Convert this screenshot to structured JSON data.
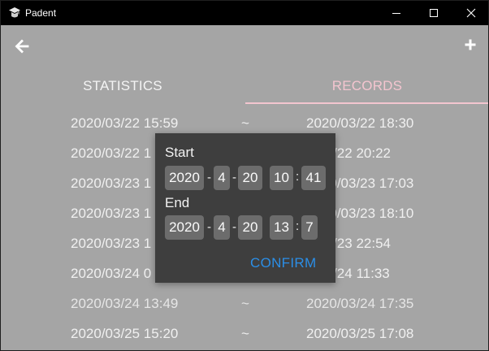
{
  "window": {
    "title": "Padent"
  },
  "tabs": [
    {
      "label": "STATISTICS"
    },
    {
      "label": "RECORDS"
    }
  ],
  "records": [
    {
      "start": "2020/03/22 15:59",
      "sep": "~",
      "end": "2020/03/22 18:30"
    },
    {
      "start": "2020/03/22 1",
      "sep": "~",
      "end": "0/03/22 20:22"
    },
    {
      "start": "2020/03/23 1",
      "sep": "~",
      "end": "2020/03/23 17:03"
    },
    {
      "start": "2020/03/23 1",
      "sep": "~",
      "end": "2020/03/23 18:10"
    },
    {
      "start": "2020/03/23 1",
      "sep": "~",
      "end": "0/03/23 22:54"
    },
    {
      "start": "2020/03/24 0",
      "sep": "~",
      "end": "0/03/24 11:33"
    },
    {
      "start": "2020/03/24 13:49",
      "sep": "~",
      "end": "2020/03/24 17:35"
    },
    {
      "start": "2020/03/25 15:20",
      "sep": "~",
      "end": "2020/03/25 17:08"
    }
  ],
  "dialog": {
    "start_label": "Start",
    "end_label": "End",
    "start": {
      "year": "2020",
      "month": "4",
      "day": "20",
      "hour": "10",
      "minute": "41"
    },
    "end": {
      "year": "2020",
      "month": "4",
      "day": "20",
      "hour": "13",
      "minute": "7"
    },
    "date_sep": "-",
    "time_sep": ":",
    "confirm_label": "CONFIRM"
  },
  "colors": {
    "background": "#a5a5a5",
    "titlebar": "#000000",
    "active_tab": "#f3c5cf",
    "dialog_bg": "#3e3e3e",
    "field_bg": "#6c6c6c",
    "confirm": "#2b8ee6"
  },
  "icons": {
    "app": "graduation-cap-icon",
    "back": "arrow-left-icon",
    "add": "plus-icon"
  }
}
